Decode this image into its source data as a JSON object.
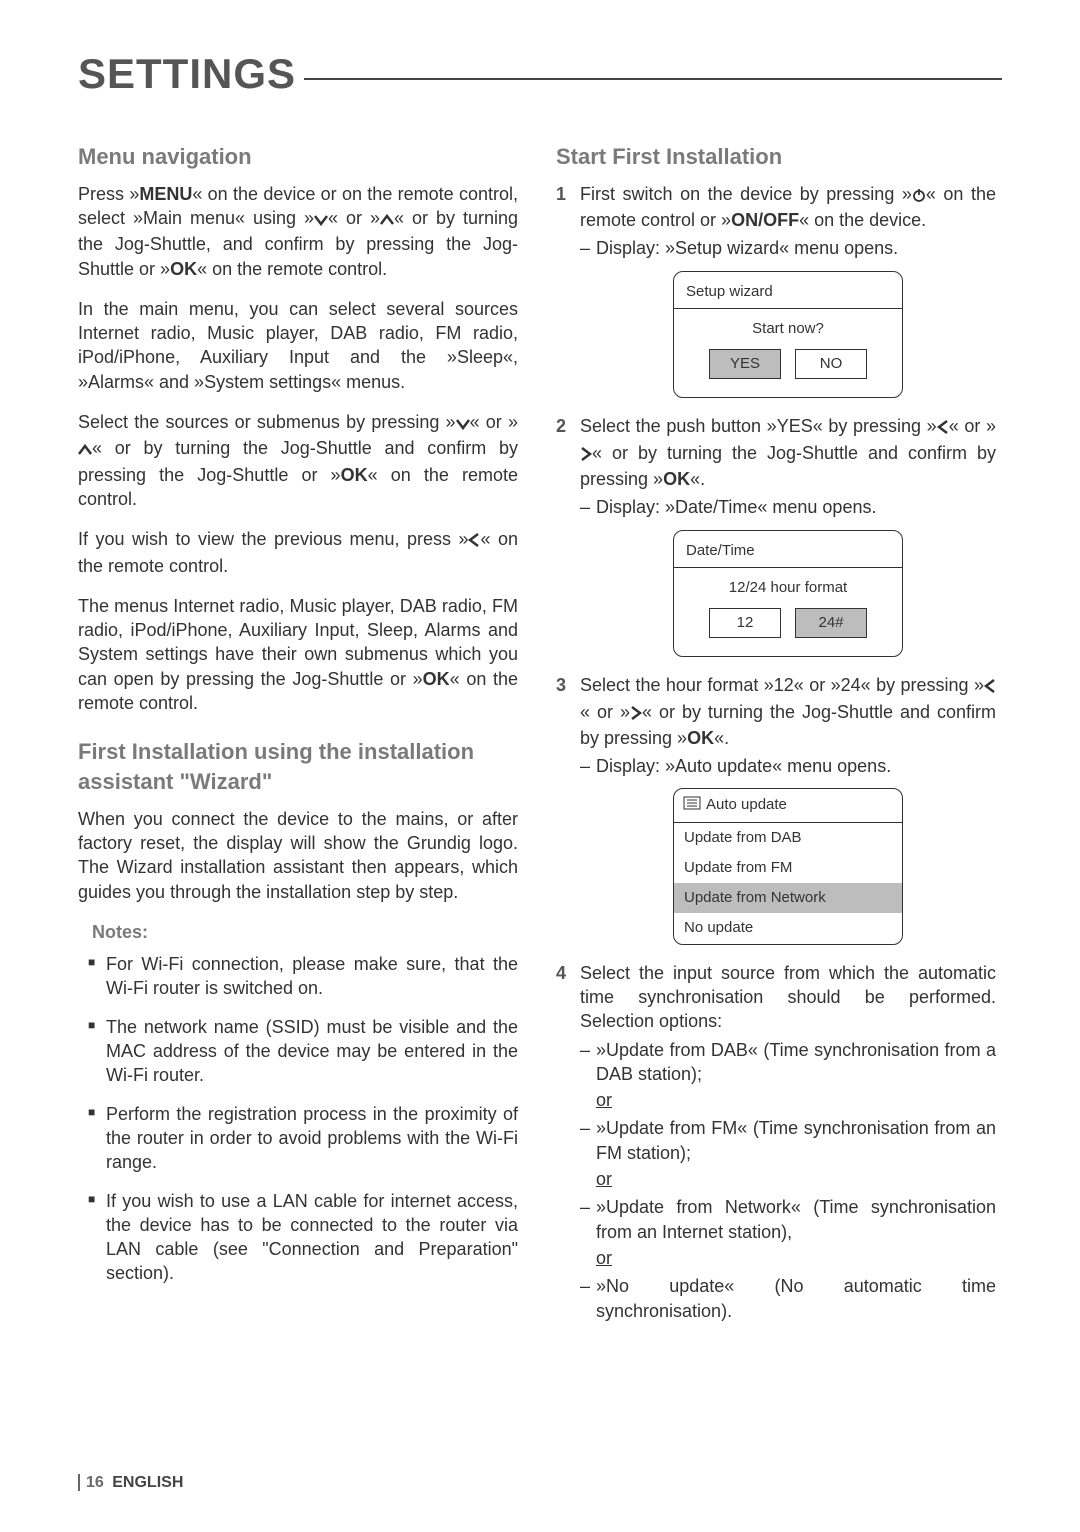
{
  "page_title": "SETTINGS",
  "left": {
    "h_menu": "Menu navigation",
    "menu_p1a": "Press »",
    "menu_p1b": "MENU",
    "menu_p1c": "« on the device or on the remote control, select »Main menu« using »",
    "menu_p1d": "« or »",
    "menu_p1e": "« or by turning the Jog-Shuttle, and confirm by pressing the Jog-Shuttle or »",
    "menu_p1f": "OK",
    "menu_p1g": "« on the remote control.",
    "menu_p2": "In the main menu, you can select several sources Internet radio, Music player, DAB radio, FM radio, iPod/iPhone, Auxiliary Input and the »Sleep«, »Alarms« and »System settings« menus.",
    "menu_p3a": "Select the sources or submenus by pressing »",
    "menu_p3b": "« or »",
    "menu_p3c": "« or by turning the Jog-Shuttle and confirm by pressing the Jog-Shuttle or »",
    "menu_p3d": "OK",
    "menu_p3e": "« on the remote control.",
    "menu_p4a": "If you wish to view the previous menu, press »",
    "menu_p4b": "« on the remote control.",
    "menu_p5a": "The menus Internet radio, Music player, DAB radio, FM radio, iPod/iPhone, Auxiliary Input, Sleep, Alarms and System settings have their own submenus which you can open by pressing the Jog-Shuttle or »",
    "menu_p5b": "OK",
    "menu_p5c": "« on the remote control.",
    "h_wizard": "First Installation using the installation assistant \"Wizard\"",
    "wiz_p1": "When you connect the device to the mains, or after factory reset, the display will show the Grundig logo. The Wizard installation assistant then appears, which guides you through the installation step by step.",
    "notes_h": "Notes:",
    "notes": [
      "For Wi-Fi connection, please make sure, that the Wi-Fi router is switched on.",
      "The network name (SSID) must be visible and the MAC address of the device may be entered in the Wi-Fi router.",
      "Perform the registration process in the proximity of the router in order to avoid problems with the Wi-Fi range.",
      "If you wish to use a LAN cable for internet access, the device has to be connected to the router via LAN cable (see \"Connection and Preparation\" section)."
    ]
  },
  "right": {
    "h_start": "Start First Installation",
    "s1a": "First switch on the device by pressing »",
    "s1b": "« on the remote control or »",
    "s1c": "ON/OFF",
    "s1d": "« on the device.",
    "s1_sub": "Display: »Setup wizard« menu opens.",
    "screen1": {
      "title": "Setup wizard",
      "prompt": "Start now?",
      "yes": "YES",
      "no": "NO"
    },
    "s2a": "Select the push button »YES« by pressing »",
    "s2b": "« or »",
    "s2c": "« or by turning the Jog-Shuttle and confirm by pressing »",
    "s2d": "OK",
    "s2e": "«.",
    "s2_sub": "Display: »Date/Time« menu opens.",
    "screen2": {
      "title": "Date/Time",
      "prompt": "12/24 hour format",
      "opt1": "12",
      "opt2": "24#"
    },
    "s3a": "Select the hour format »12« or »24« by pressing »",
    "s3b": "« or »",
    "s3c": "« or by turning the Jog-Shuttle and confirm by pressing »",
    "s3d": "OK",
    "s3e": "«.",
    "s3_sub": "Display: »Auto update« menu opens.",
    "screen3": {
      "title": "Auto update",
      "rows": [
        "Update from DAB",
        "Update from FM",
        "Update from Network",
        "No update"
      ],
      "selected": 2
    },
    "s4_lead": "Select the input source from which the automatic time synchronisation should be performed. Selection options:",
    "s4_opts": [
      "»Update from DAB« (Time synchronisation from a DAB station);",
      "»Update from FM« (Time synchronisation from an FM station);",
      "»Update from Network« (Time synchronisation from an Internet station),",
      "»No update« (No automatic time synchronisation)."
    ],
    "or": "or"
  },
  "footer": {
    "page": "16",
    "lang": "ENGLISH"
  }
}
